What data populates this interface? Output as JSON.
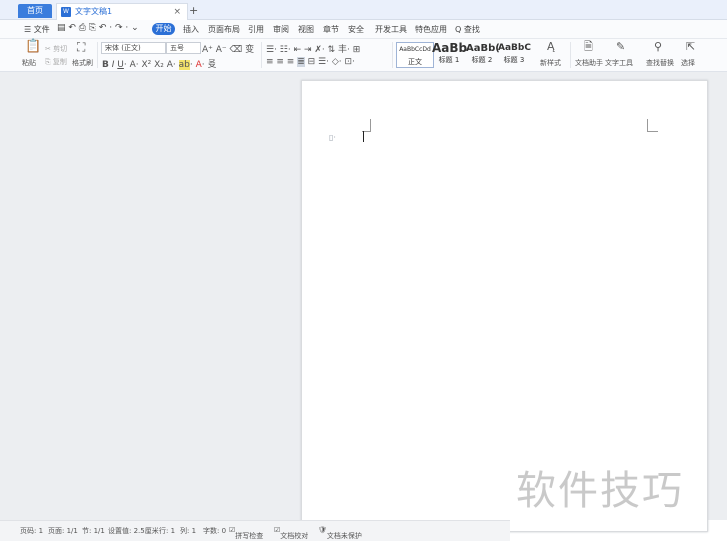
{
  "tabs": {
    "home": "首页",
    "doc_title": "文字文稿1",
    "doc_icon": "W",
    "close": "×",
    "add": "+"
  },
  "menu": {
    "file": "☰ 文件",
    "active": "开始",
    "items": [
      "插入",
      "页面布局",
      "引用",
      "审阅",
      "视图",
      "章节",
      "安全",
      "开发工具",
      "特色应用"
    ],
    "search": "Q 查找"
  },
  "ribbon": {
    "paste": "粘贴",
    "cut": "剪切",
    "copy": "复制",
    "format_painter": "格式刷",
    "font_name": "宋体 (正文)",
    "font_size": "五号",
    "styles": [
      {
        "preview": "AaBbCcDd",
        "label": "正文"
      },
      {
        "preview": "AaBb",
        "label": "标题 1"
      },
      {
        "preview": "AaBb(",
        "label": "标题 2"
      },
      {
        "preview": "AaBbC",
        "label": "标题 3"
      }
    ],
    "new_style": "新样式",
    "doc_assistant": "文档助手",
    "text_tools": "文字工具",
    "find_replace": "查找替换",
    "select": "选择"
  },
  "status": {
    "page": "页码: 1",
    "pages": "页面: 1/1",
    "section": "节: 1/1",
    "setting": "设置值: 2.5厘米",
    "row": "行: 1",
    "col": "列: 1",
    "words": "字数: 0",
    "spell": "拼写检查",
    "proofread": "文档校对",
    "protect": "文档未保护"
  },
  "watermark": "软件技巧"
}
